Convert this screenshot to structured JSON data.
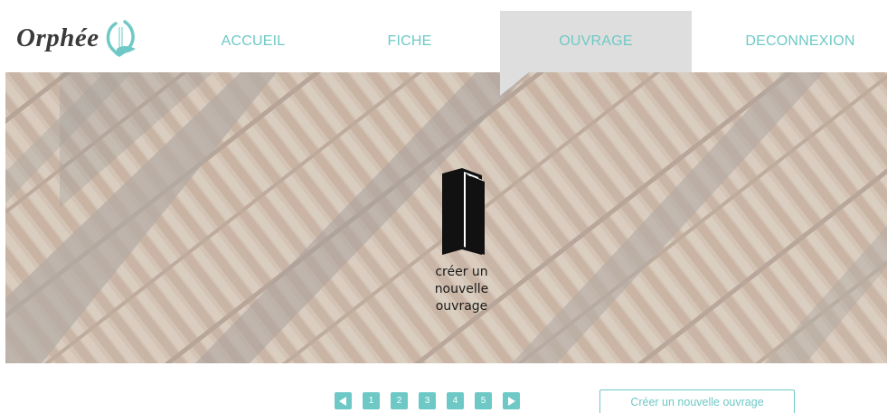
{
  "brand": {
    "name": "Orphée",
    "logo_icon": "lyre-icon",
    "accent_color": "#6ec9c6"
  },
  "nav": {
    "items": [
      {
        "label": "ACCUEIL",
        "active": false
      },
      {
        "label": "FICHE",
        "active": false
      },
      {
        "label": "OUVRAGE",
        "active": true
      },
      {
        "label": "DECONNEXION",
        "active": false
      }
    ]
  },
  "hero": {
    "background": "bookshelf-photo",
    "icon": "book-icon",
    "label_line1": "créer un",
    "label_line2": "nouvelle",
    "label_line3": "ouvrage"
  },
  "pagination": {
    "prev_icon": "arrow-left-icon",
    "pages": [
      "1",
      "2",
      "3",
      "4",
      "5"
    ],
    "next_icon": "arrow-right-icon"
  },
  "actions": {
    "create_button_label": "Créer un nouvelle ouvrage"
  }
}
